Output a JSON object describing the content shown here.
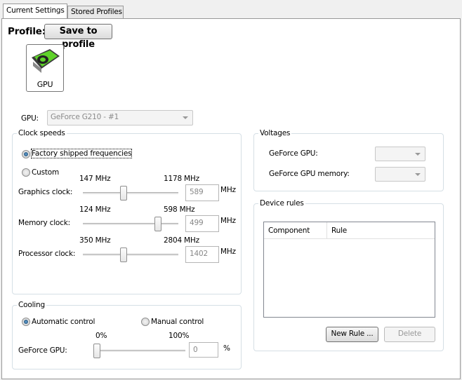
{
  "tabs": [
    {
      "label": "Current Settings",
      "active": true
    },
    {
      "label": "Stored Profiles",
      "active": false
    }
  ],
  "profile": {
    "label": "Profile:",
    "save_button": "Save to profile"
  },
  "device_icon": {
    "label": "GPU",
    "icon": "gpu-card-icon"
  },
  "gpu_select": {
    "label": "GPU:",
    "value": "GeForce G210 - #1"
  },
  "clock": {
    "title": "Clock speeds",
    "factory_label": "Factory shipped frequencies",
    "custom_label": "Custom",
    "mode": "factory",
    "rows": [
      {
        "label": "Graphics clock:",
        "min": "147 MHz",
        "max": "1178 MHz",
        "value": "589",
        "unit": "MHz",
        "fraction": 0.43
      },
      {
        "label": "Memory clock:",
        "min": "124 MHz",
        "max": "598 MHz",
        "value": "499",
        "unit": "MHz",
        "fraction": 0.79
      },
      {
        "label": "Processor clock:",
        "min": "350 MHz",
        "max": "2804 MHz",
        "value": "1402",
        "unit": "MHz",
        "fraction": 0.43
      }
    ]
  },
  "cooling": {
    "title": "Cooling",
    "auto_label": "Automatic control",
    "manual_label": "Manual control",
    "mode": "auto",
    "min": "0%",
    "max": "100%",
    "gpu_label": "GeForce GPU:",
    "value": "0",
    "unit": "%",
    "fraction": 0
  },
  "voltages": {
    "title": "Voltages",
    "gpu_label": "GeForce GPU:",
    "memory_label": "GeForce GPU memory:"
  },
  "rules": {
    "title": "Device rules",
    "columns": [
      "Component",
      "Rule"
    ],
    "rows": [],
    "new_button": "New Rule ...",
    "delete_button": "Delete"
  }
}
